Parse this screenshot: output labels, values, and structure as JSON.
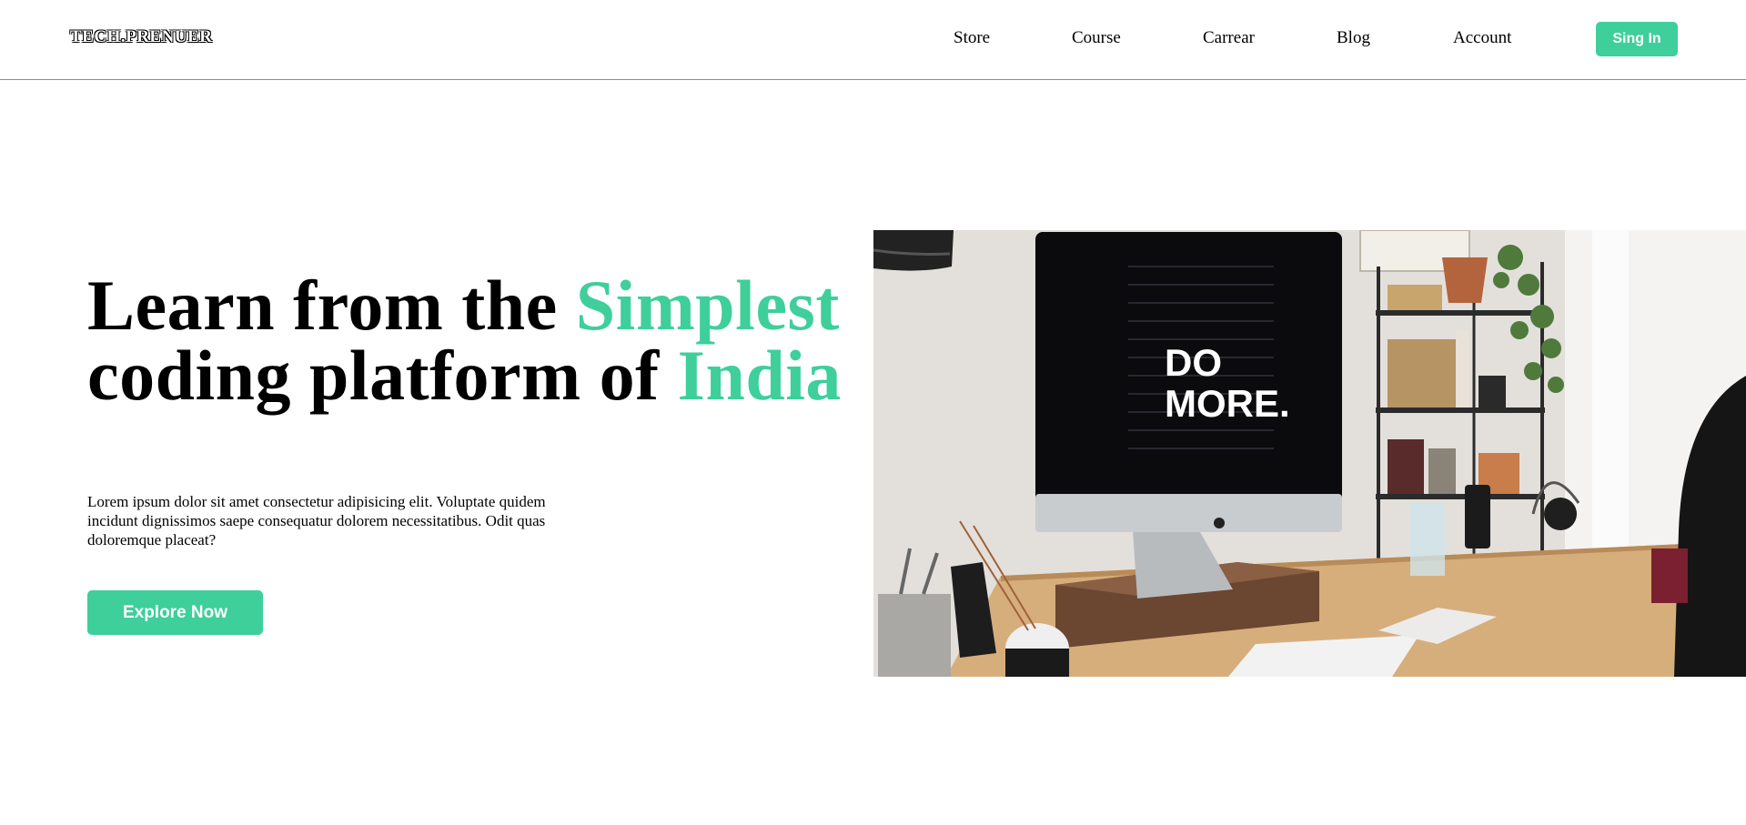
{
  "brand": {
    "logo": "TECH.PRENUER"
  },
  "nav": {
    "links": [
      "Store",
      "Course",
      "Carrear",
      "Blog",
      "Account"
    ],
    "signin_label": "Sing In"
  },
  "hero": {
    "title_part1": "Learn from the ",
    "title_accent1": "Simplest",
    "title_part2": " coding platform of ",
    "title_accent2": "India",
    "description": "Lorem ipsum dolor sit amet consectetur adipisicing elit. Voluptate quidem incidunt dignissimos saepe consequatur dolorem necessitatibus. Odit quas doloremque placeat?",
    "cta_label": "Explore Now"
  },
  "image": {
    "screen_text_line1": "DO",
    "screen_text_line2": "MORE."
  },
  "colors": {
    "accent": "#3ecf9b"
  }
}
